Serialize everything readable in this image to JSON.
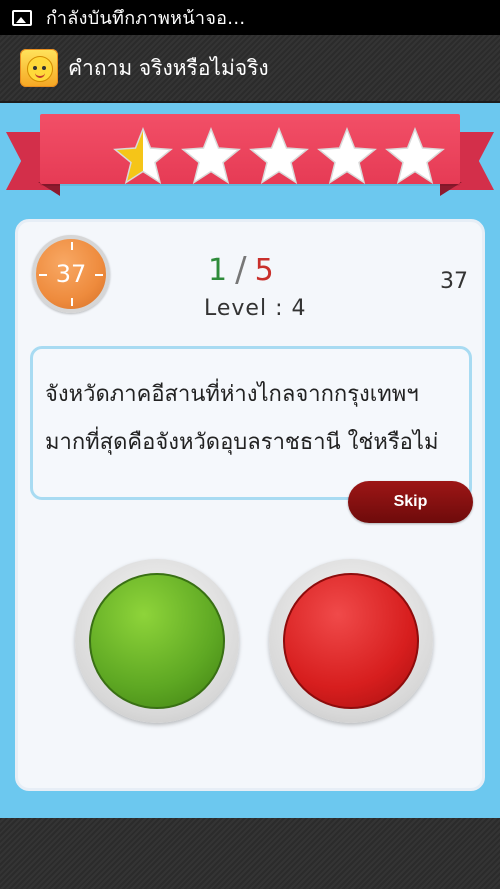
{
  "status_bar": {
    "text": "กำลังบันทึกภาพหน้าจอ..."
  },
  "app_bar": {
    "title": "คำถาม จริงหรือไม่จริง"
  },
  "rating": {
    "stars_total": 5,
    "stars_filled": 0.5,
    "star_color": "#f5c518",
    "empty_color": "#ffffff",
    "ribbon_color": "#e63b55"
  },
  "quiz": {
    "timer": "37",
    "current": "1",
    "separator": "/",
    "total": "5",
    "level": "Level : 4",
    "points": "37",
    "question_line1": "จังหวัดภาคอีสานที่ห่างไกลจากกรุงเทพฯ",
    "question_line2": "มากที่สุดคือจังหวัดอุบลราชธานี ใช่หรือไม่",
    "skip_label": "Skip"
  },
  "colors": {
    "true_button": "#5ea823",
    "false_button": "#d71e1e",
    "background": "#6cc8ef"
  }
}
